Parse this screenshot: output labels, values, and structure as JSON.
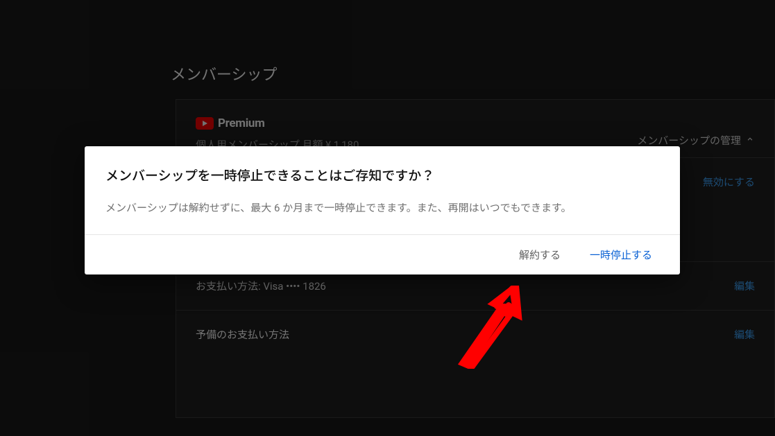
{
  "page": {
    "title": "メンバーシップ"
  },
  "card": {
    "premium_label": "Premium",
    "plan_line": "個人用メンバーシップ  月額 ¥ 1,180",
    "manage_label": "メンバーシップの管理"
  },
  "rows": {
    "disable_action": "無効にする",
    "payment_method_label": "お支払い方法: Visa •••• 1826",
    "edit_action": "編集",
    "backup_payment_label": "予備のお支払い方法",
    "backup_edit_action": "編集"
  },
  "dialog": {
    "title": "メンバーシップを一時停止できることはご存知ですか？",
    "body": "メンバーシップは解約せずに、最大 6 か月まで一時停止できます。また、再開はいつでもできます。",
    "cancel_label": "解約する",
    "pause_label": "一時停止する"
  }
}
